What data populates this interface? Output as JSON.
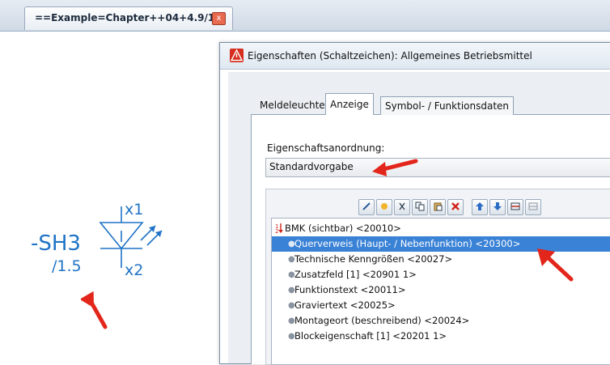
{
  "document_tab": {
    "title": "==Example=Chapter++04+4.9/1",
    "close": "x"
  },
  "canvas": {
    "bmk": "-SH3",
    "reference": "/1.5",
    "connection_top": "x1",
    "connection_bottom": "x2"
  },
  "dialog": {
    "title": "Eigenschaften (Schaltzeichen): Allgemeines Betriebsmittel",
    "tabs": [
      {
        "label": "Meldeleuchte"
      },
      {
        "label": "Anzeige"
      },
      {
        "label": "Symbol- / Funktionsdaten"
      }
    ],
    "active_tab": "Anzeige",
    "arrangement_label": "Eigenschaftsanordnung:",
    "arrangement_value": "Standardvorgabe",
    "toolbar": [
      "edit-icon",
      "new-icon",
      "cut-icon",
      "copy-icon",
      "paste-icon",
      "delete-icon",
      "move-up-icon",
      "move-down-icon",
      "split-icon",
      "merge-icon"
    ],
    "properties": [
      {
        "label": "BMK (sichtbar) <20010>",
        "level": "parent"
      },
      {
        "label": "Querverweis (Haupt- / Nebenfunktion) <20300>",
        "level": "child",
        "selected": true
      },
      {
        "label": "Technische Kenngrößen <20027>",
        "level": "child"
      },
      {
        "label": "Zusatzfeld [1] <20901 1>",
        "level": "child"
      },
      {
        "label": "Funktionstext <20011>",
        "level": "child"
      },
      {
        "label": "Graviertext <20025>",
        "level": "child"
      },
      {
        "label": "Montageort (beschreibend) <20024>",
        "level": "child"
      },
      {
        "label": "Blockeigenschaft [1] <20201 1>",
        "level": "child"
      }
    ]
  },
  "colors": {
    "accent": "#1f73c6",
    "selection": "#3a82d6",
    "annotation_arrow": "#e3261b"
  }
}
